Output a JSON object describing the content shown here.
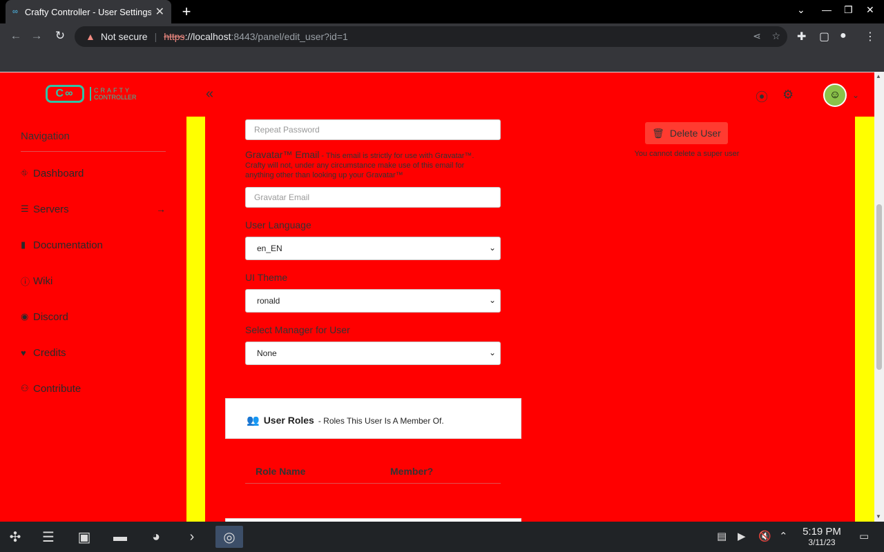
{
  "browser": {
    "tab_title": "Crafty Controller - User Settings",
    "tab_favicon": "∞",
    "close_glyph": "✕",
    "new_tab_glyph": "+",
    "security_label": "Not secure",
    "url_scheme": "https",
    "url_host": "://localhost",
    "url_path": ":8443/panel/edit_user?id=1",
    "window_controls": [
      "⌄",
      "—",
      "❐",
      "✕"
    ]
  },
  "topnav": {
    "logo_mark": "C∞",
    "logo_text_1": "CRAFTY",
    "logo_text_2": "CONTROLLER",
    "collapse_glyph": "«"
  },
  "sidebar": {
    "title": "Navigation",
    "items": [
      {
        "label": "Dashboard",
        "icon": "⛗"
      },
      {
        "label": "Servers",
        "icon": "☰"
      },
      {
        "label": "Documentation",
        "icon": "▮"
      },
      {
        "label": "Wiki",
        "icon": "ⓘ"
      },
      {
        "label": "Discord",
        "icon": "◉"
      },
      {
        "label": "Credits",
        "icon": "♥"
      },
      {
        "label": "Contribute",
        "icon": "⚇"
      }
    ],
    "servers_arrow": "→"
  },
  "form": {
    "repeat_password_placeholder": "Repeat Password",
    "gravatar_label": "Gravatar™ Email",
    "gravatar_help": " - This email is strictly for use with Gravatar™. Crafty will not, under any circumstance make use of this email for anything other than looking up your Gravatar™",
    "gravatar_placeholder": "Gravatar Email",
    "language_label": "User Language",
    "language_value": "en_EN",
    "theme_label": "UI Theme",
    "theme_value": "ronald",
    "manager_label": "Select Manager for User",
    "manager_value": "None"
  },
  "delete": {
    "button_label": "Delete User",
    "note": "You cannot delete a super user"
  },
  "roles": {
    "title": "User Roles",
    "subtitle": "- Roles This User Is A Member Of.",
    "col_role": "Role Name",
    "col_member": "Member?"
  },
  "clock": {
    "time": "5:19 PM",
    "date": "3/11/23"
  },
  "colors": {
    "page_bg": "#ff0000",
    "content_frame": "#ffff00"
  }
}
